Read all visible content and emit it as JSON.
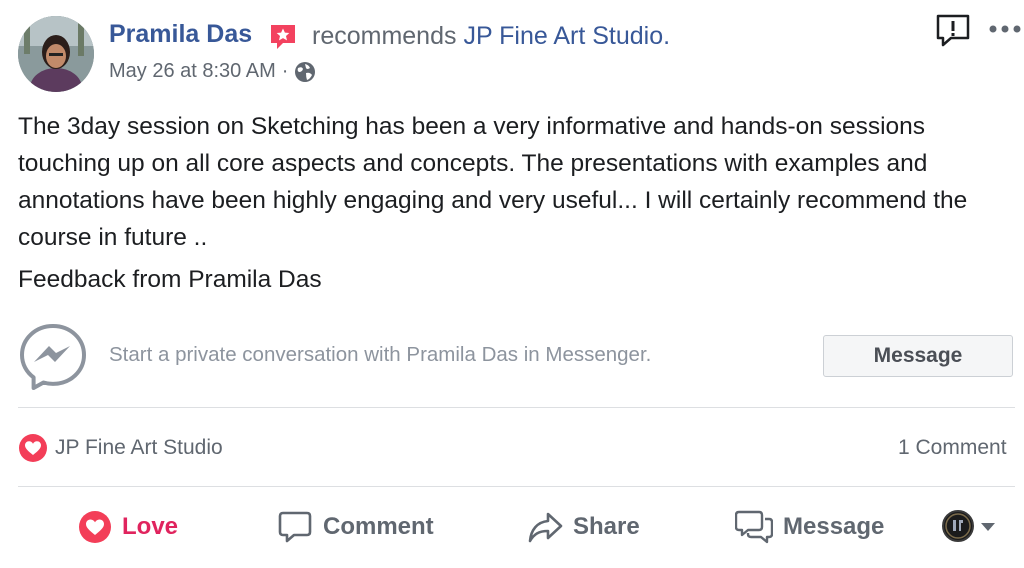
{
  "post": {
    "author": "Pramila Das",
    "action_text": "recommends",
    "page_name": "JP Fine Art Studio",
    "page_suffix": ".",
    "timestamp": "May 26 at 8:30 AM",
    "separator": "·",
    "privacy_icon": "globe-icon",
    "body": "The 3day session on Sketching has been a very informative and hands-on sessions touching up on all core aspects and concepts. The presentations with examples and annotations have been highly engaging and very useful... I will certainly recommend the course in future ..",
    "feedback": "Feedback from Pramila Das"
  },
  "messenger": {
    "prompt": "Start a private conversation with Pramila Das in Messenger.",
    "button_label": "Message"
  },
  "reactions": {
    "icon": "heart-icon",
    "by": "JP Fine Art Studio",
    "comments": "1 Comment"
  },
  "actions": {
    "love": "Love",
    "comment": "Comment",
    "share": "Share",
    "message": "Message"
  },
  "colors": {
    "link": "#385898",
    "love": "#e0245e",
    "muted": "#606770"
  }
}
